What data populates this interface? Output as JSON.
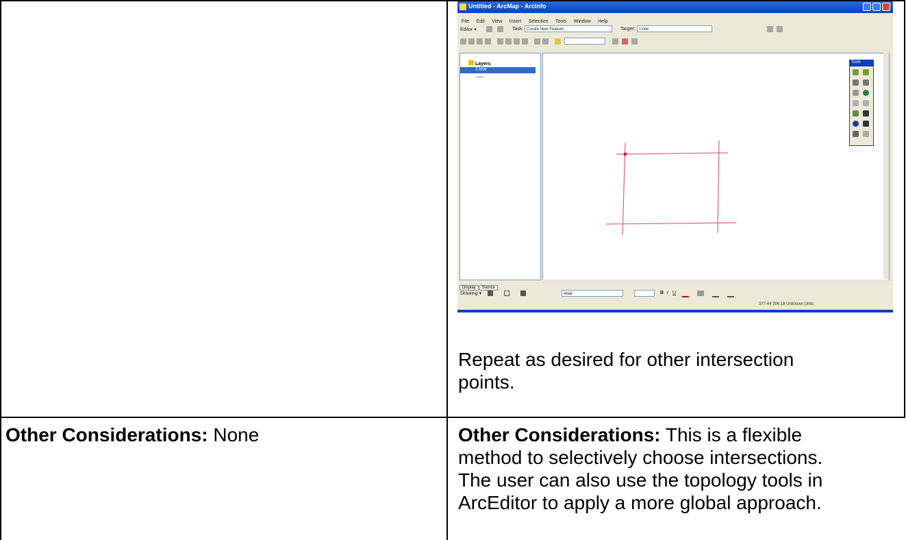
{
  "left_column": {
    "other_considerations_label": "Other Considerations:",
    "other_considerations_value": " None"
  },
  "right_column": {
    "repeat_line1": "Repeat as desired for other intersection",
    "repeat_line2": "points.",
    "other_considerations_label": "Other Considerations:",
    "other_line1_rest": " This is a flexible",
    "other_line2": "method to selectively choose intersections.",
    "other_line3": "The user can also use the topology tools in",
    "other_line4": "ArcEditor to apply a more global approach."
  },
  "screenshot": {
    "window_title": "Untitled - ArcMap - ArcInfo",
    "menu": [
      "File",
      "Edit",
      "View",
      "Insert",
      "Selection",
      "Tools",
      "Window",
      "Help"
    ],
    "editor_label": "Editor ▾",
    "task_label": "Task:",
    "task_value": "Create New Feature",
    "target_label": "Target:",
    "target_value": "1 line",
    "layers_label": "Layers",
    "layer_name": "1 line",
    "toc_tab_display": "Display",
    "toc_tab_source": "Source",
    "tools_title": "Tools",
    "drawing_label": "Drawing ▾",
    "font_value": "Arial",
    "status_text": "377.44  396.18 Unknown Units",
    "colors": {
      "line": "#e0607a",
      "vertex": "#d0203a",
      "title_blue": "#0a3fc0"
    }
  }
}
